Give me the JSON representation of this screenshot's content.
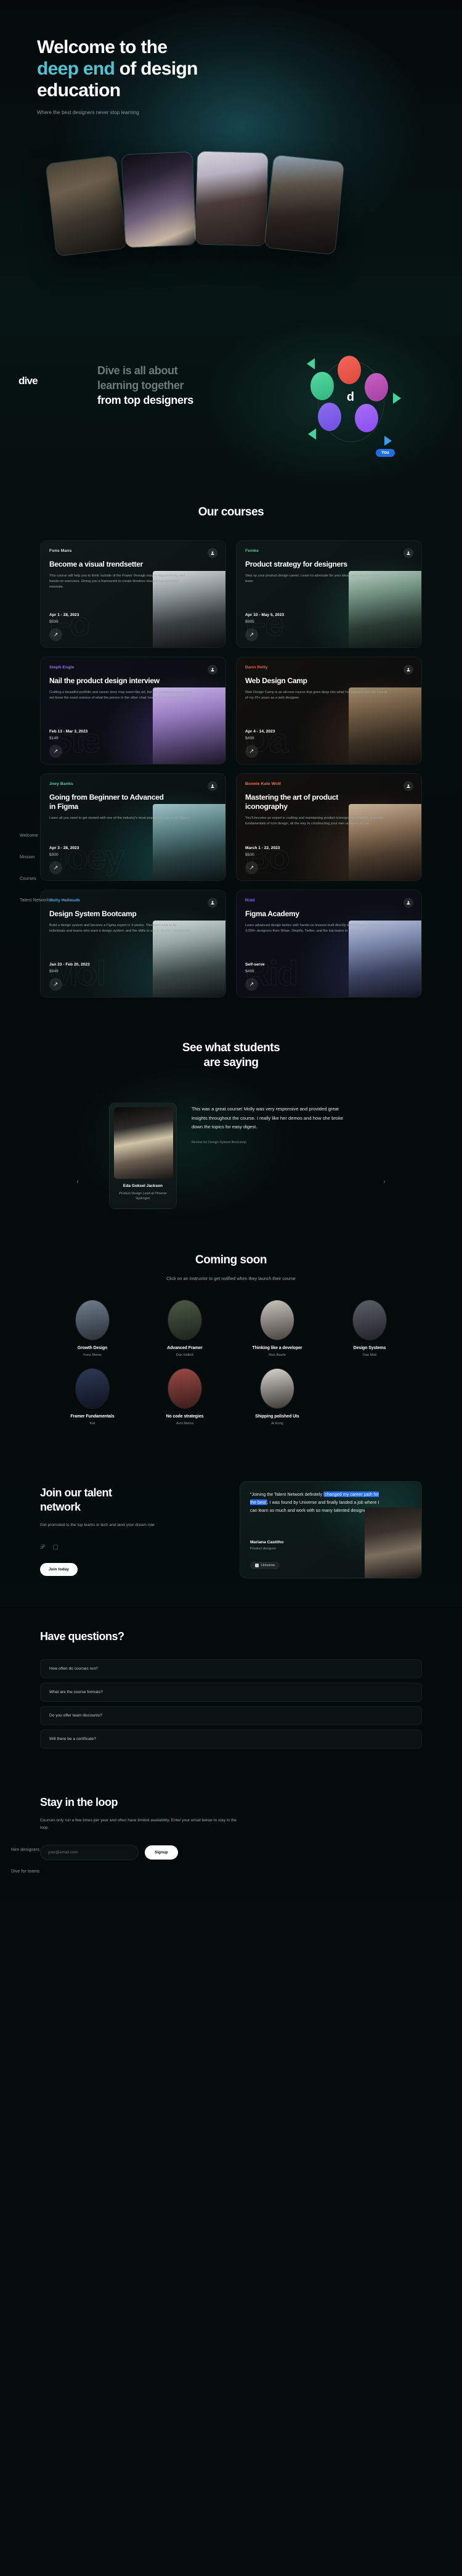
{
  "hero": {
    "title_line1": "Welcome to the",
    "title_highlight": "deep end",
    "title_rest": " of design",
    "title_line3": "education",
    "subtitle": "Where the best designers never stop learning",
    "cards": [
      "hero-photo-1",
      "hero-photo-2",
      "hero-photo-3",
      "hero-photo-4"
    ]
  },
  "mission": {
    "brand": "dive",
    "line1": "Dive is all about",
    "line2": "learning together",
    "line3": "from top designers",
    "you_badge": "You",
    "orbit_logo": "d"
  },
  "sidenav": {
    "items": [
      {
        "label": "Welcome"
      },
      {
        "label": "Mission"
      },
      {
        "label": "Courses"
      },
      {
        "label": "Talent Network"
      }
    ],
    "items2": [
      {
        "label": "Hire designers"
      },
      {
        "label": "Dive for teams"
      }
    ]
  },
  "courses": {
    "title": "Our courses",
    "cards": [
      {
        "author": "Fons Mans",
        "author_color": "#d9e2e1",
        "watermark": "Fo",
        "title": "Become a visual trendsetter",
        "desc": "This course will help you to think 'outside of the Frame' through easy to digest theory and hands-on exercises. Giving you a framework to create timeless visual languages that resonate.",
        "date": "Apr 1 - 28, 2023",
        "price": "$599"
      },
      {
        "author": "Femke",
        "author_color": "#3fd68a",
        "watermark": "Fe",
        "title": "Product strategy for designers",
        "desc": "Step up your product design career. Learn to advocate for your ideas and influence your team.",
        "date": "Apr 10 - May 5, 2023",
        "price": "$985"
      },
      {
        "author": "Steph Engle",
        "author_color": "#9a6cf5",
        "watermark": "Ste",
        "title": "Nail the product design interview",
        "desc": "Crafting a beautiful portfolio and career story may seem like art, but the candidates who stand out know the exact science of what the person in the other chair needs to see to get to \"yes\".",
        "date": "Feb 13 - Mar 3, 2023",
        "price": "$149"
      },
      {
        "author": "Dann Petty",
        "author_color": "#f0604d",
        "watermark": "Da",
        "title": "Web Design Camp",
        "desc": "Web Design Camp is an all-new course that goes deep into what I've learned over the course of my 20+ years as a web designer.",
        "date": "Apr 4 - 14, 2023",
        "price": "$499"
      },
      {
        "author": "Joey Banks",
        "author_color": "#3fd6b4",
        "watermark": "Joey",
        "title": "Going from Beginner to Advanced in Figma",
        "desc": "Learn all you need to get started with one of the industry's most popular design tools: Figma.",
        "date": "Apr 3 - 28, 2023",
        "price": "$300"
      },
      {
        "author": "Bonnie Kate Wolf",
        "author_color": "#f0785c",
        "watermark": "Bo",
        "title": "Mastering the art of product iconography",
        "desc": "You'll become an expert in crafting and maintaining product iconography systems, from the fundamentals of icon design, all the way to constructing your own unique icon set.",
        "date": "March 1 - 22, 2023",
        "price": "$500"
      },
      {
        "author": "Molly Hellmuth",
        "author_color": "#5aa8f5",
        "watermark": "Mol",
        "title": "Design System Bootcamp",
        "desc": "Build a design system and become a Figma expert in 4 weeks. This bootcamp is for individuals and teams who want a design system, and the skills to use it, they're confident in.",
        "date": "Jan 23 - Feb 20, 2023",
        "price": "$949"
      },
      {
        "author": "Ridd",
        "author_color": "#7b6cf5",
        "watermark": "Rid",
        "title": "Figma Academy",
        "desc": "Learn advanced design tactics with hands-on lessons built directly within Figma. Trusted by 3,000+ designers from Stripe, Shopify, Twitter, and the top teams in tech.",
        "date": "Self-serve",
        "price": "$499"
      }
    ]
  },
  "testimonials": {
    "title_line1": "See what students",
    "title_line2": "are saying",
    "student_name": "Eda Goksel Jackson",
    "student_role": "Product Design Lead at Phoenix Hydrogen",
    "quote": "This was a great course! Molly was very responsive and provided great insights throughout the course. I really like her demos and how she broke down the topics for easy digest.",
    "source": "Review for Design System Bootcamp",
    "prev": "‹",
    "next": "›"
  },
  "coming_soon": {
    "title": "Coming soon",
    "subtitle": "Click on an instructor to get notified when they launch their course",
    "instructors": [
      {
        "course": "Growth Design",
        "name": "Fonz Morris",
        "color1": "#6f7d8c",
        "color2": "#2a3138"
      },
      {
        "course": "Advanced Framer",
        "name": "Dan Hollick",
        "color1": "#4a5a44",
        "color2": "#1d231c"
      },
      {
        "course": "Thinking like a developer",
        "name": "Nick Basile",
        "color1": "#c9c4bd",
        "color2": "#484340"
      },
      {
        "course": "Design Systems",
        "name": "Dan Mall",
        "color1": "#5b5f66",
        "color2": "#22242a"
      },
      {
        "course": "Framer Fundamentals",
        "name": "Kat",
        "color1": "#2d3a55",
        "color2": "#0e1320"
      },
      {
        "course": "No code strategies",
        "name": "Avni Mehta",
        "color1": "#9b4a45",
        "color2": "#3a1c1a"
      },
      {
        "course": "Shipping polished UIs",
        "name": "Al Kong",
        "color1": "#d7d3cd",
        "color2": "#3a3734"
      }
    ]
  },
  "talent": {
    "title_line1": "Join our talent",
    "title_line2": "network",
    "desc": "Get promoted to the top teams in tech and land your dream role",
    "button": "Join today",
    "quote_pre": "\"Joining the Talent Network definitely ",
    "quote_mark": "changed my career path for the best",
    "quote_post": ". I was found by Universe and finally landed a job where I can learn so much and work with so many talented designers\"",
    "person_name": "Mariana Castilho",
    "person_role": "Product designer",
    "chip": "Universe",
    "social_icons": [
      "twitter-icon",
      "instagram-icon"
    ]
  },
  "faq": {
    "title": "Have questions?",
    "items": [
      "How often do courses run?",
      "What are the course formats?",
      "Do you offer team discounts?",
      "Will there be a certificate?"
    ]
  },
  "newsletter": {
    "title": "Stay in the loop",
    "desc": "Courses only run a few times per year and often have limited availability. Enter your email below to stay in the loop.",
    "placeholder": "your@email.com",
    "button": "Signup"
  }
}
